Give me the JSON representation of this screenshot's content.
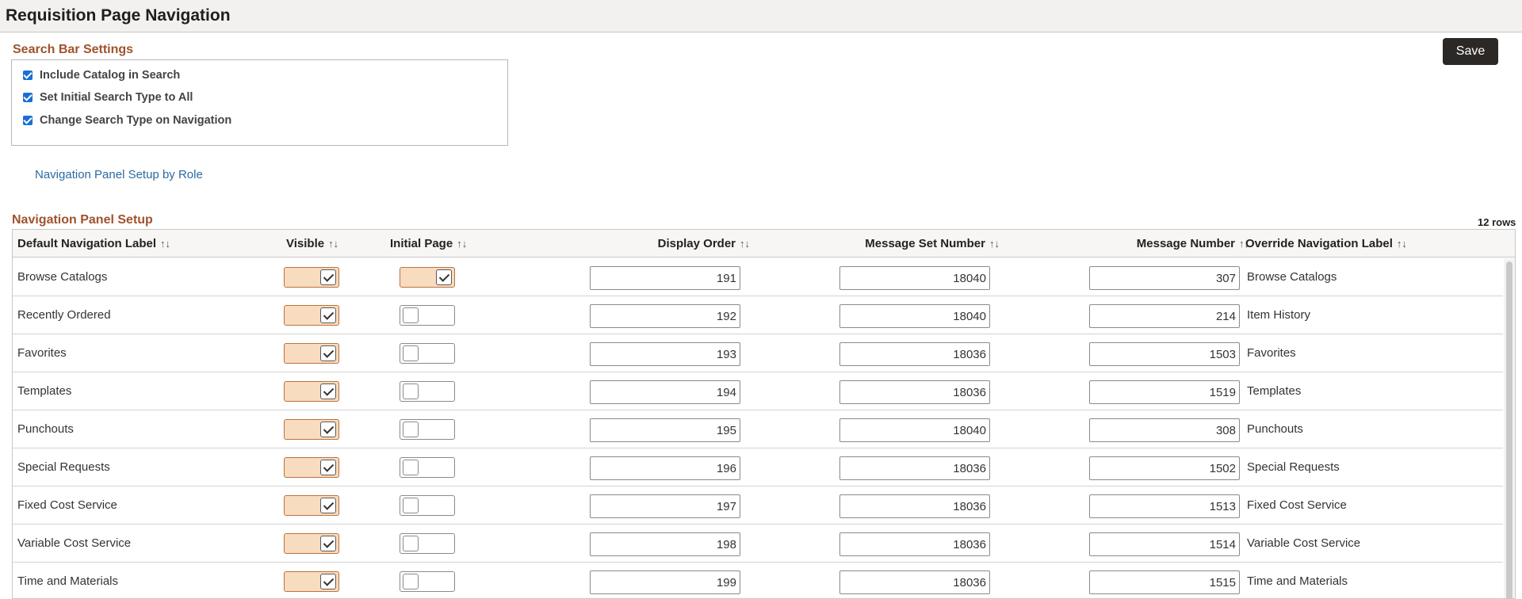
{
  "page_title": "Requisition Page Navigation",
  "save_label": "Save",
  "search_settings": {
    "title": "Search Bar Settings",
    "options": [
      {
        "label": "Include Catalog in Search",
        "checked": true
      },
      {
        "label": "Set Initial Search Type to All",
        "checked": true
      },
      {
        "label": "Change Search Type on Navigation",
        "checked": true
      }
    ]
  },
  "role_link": "Navigation Panel Setup by Role",
  "nav_panel": {
    "title": "Navigation Panel Setup",
    "row_count": "12 rows",
    "columns": {
      "default_label": "Default Navigation Label",
      "visible": "Visible",
      "initial_page": "Initial Page",
      "display_order": "Display Order",
      "message_set": "Message Set Number",
      "message_number": "Message Number",
      "override_label": "Override Navigation Label"
    },
    "sort_icon": "↑↓",
    "rows": [
      {
        "label": "Browse Catalogs",
        "visible": true,
        "initial": true,
        "order": "191",
        "msgset": "18040",
        "msgnum": "307",
        "override": "Browse Catalogs"
      },
      {
        "label": "Recently Ordered",
        "visible": true,
        "initial": false,
        "order": "192",
        "msgset": "18040",
        "msgnum": "214",
        "override": "Item History"
      },
      {
        "label": "Favorites",
        "visible": true,
        "initial": false,
        "order": "193",
        "msgset": "18036",
        "msgnum": "1503",
        "override": "Favorites"
      },
      {
        "label": "Templates",
        "visible": true,
        "initial": false,
        "order": "194",
        "msgset": "18036",
        "msgnum": "1519",
        "override": "Templates"
      },
      {
        "label": "Punchouts",
        "visible": true,
        "initial": false,
        "order": "195",
        "msgset": "18040",
        "msgnum": "308",
        "override": "Punchouts"
      },
      {
        "label": "Special Requests",
        "visible": true,
        "initial": false,
        "order": "196",
        "msgset": "18036",
        "msgnum": "1502",
        "override": "Special Requests"
      },
      {
        "label": "Fixed Cost Service",
        "visible": true,
        "initial": false,
        "order": "197",
        "msgset": "18036",
        "msgnum": "1513",
        "override": "Fixed Cost Service"
      },
      {
        "label": "Variable Cost Service",
        "visible": true,
        "initial": false,
        "order": "198",
        "msgset": "18036",
        "msgnum": "1514",
        "override": "Variable Cost Service"
      },
      {
        "label": "Time and Materials",
        "visible": true,
        "initial": false,
        "order": "199",
        "msgset": "18036",
        "msgnum": "1515",
        "override": "Time and Materials"
      }
    ]
  }
}
